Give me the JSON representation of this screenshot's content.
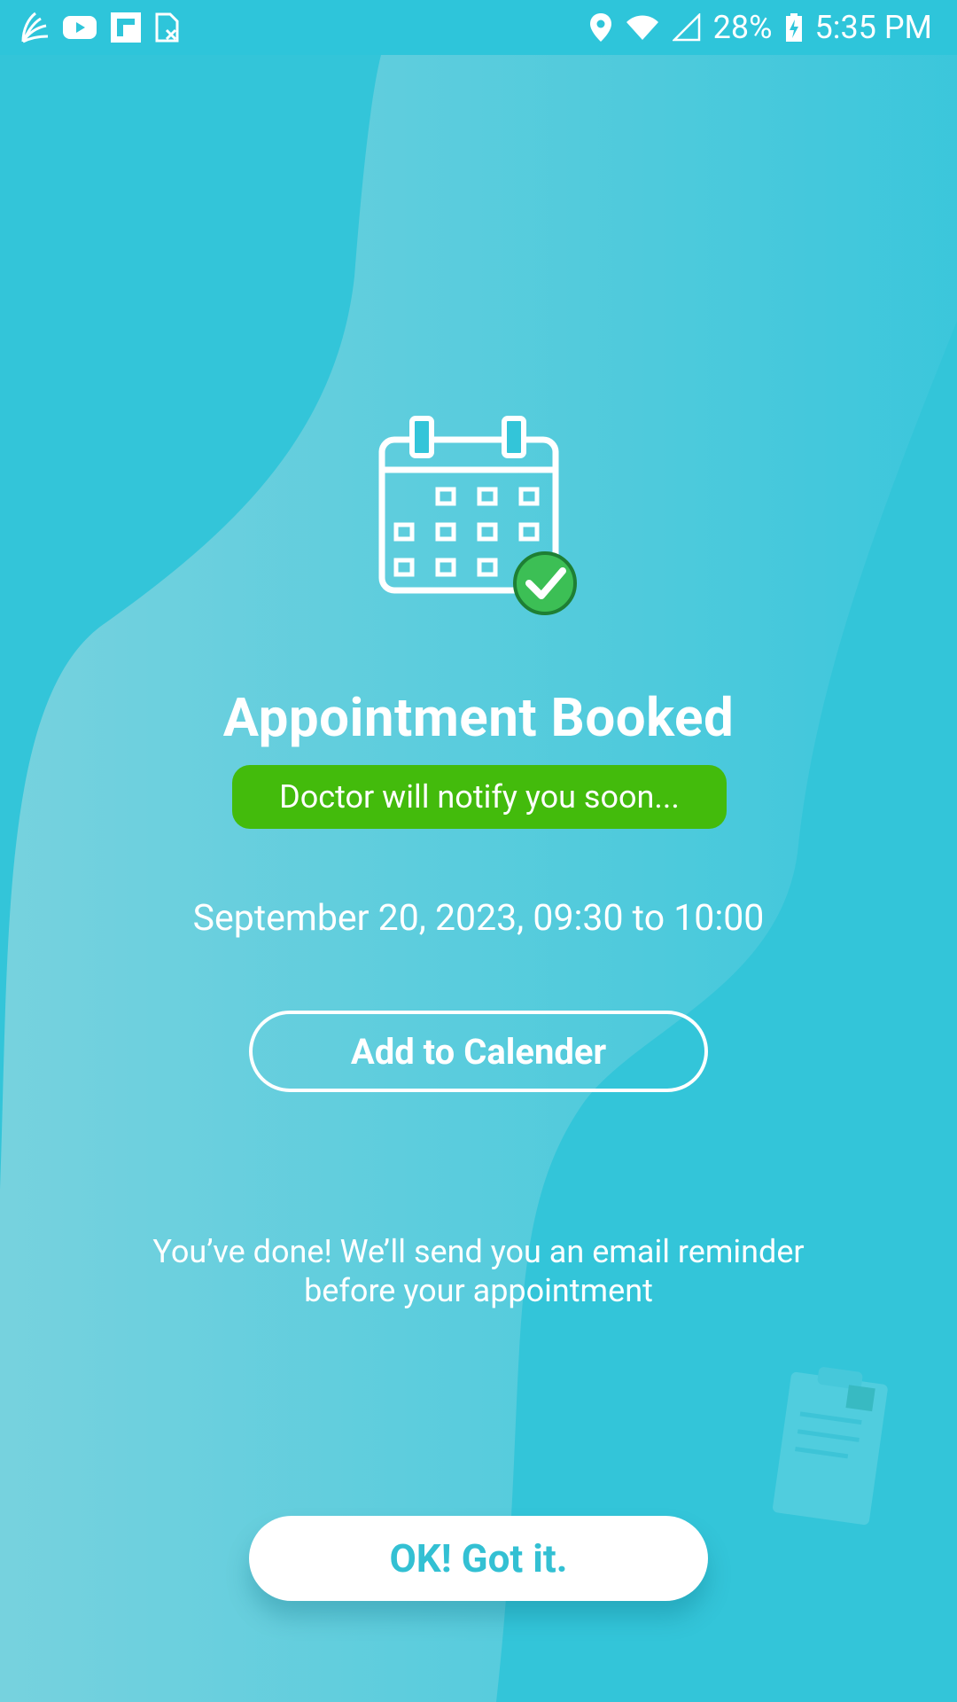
{
  "status_bar": {
    "left_icons": [
      "notification-app-icon",
      "youtube-icon",
      "flipboard-icon",
      "sim-off-icon"
    ],
    "right_icons": [
      "location-icon",
      "wifi-icon",
      "signal-icon",
      "battery-charging-icon"
    ],
    "battery_percent": "28%",
    "time": "5:35 PM"
  },
  "main": {
    "icon": "calendar-check-icon",
    "title": "Appointment Booked",
    "notify_badge": "Doctor will notify you soon...",
    "datetime": "September 20, 2023, 09:30 to 10:00",
    "add_to_calendar_label": "Add to Calender",
    "reminder_line1": "You’ve done! We’ll send you an email reminder",
    "reminder_line2": "before your appointment",
    "ok_label": "OK! Got it."
  },
  "colors": {
    "background": "#33c5d9",
    "badge_green": "#43bb0c",
    "button_text": "#33c0d3"
  }
}
